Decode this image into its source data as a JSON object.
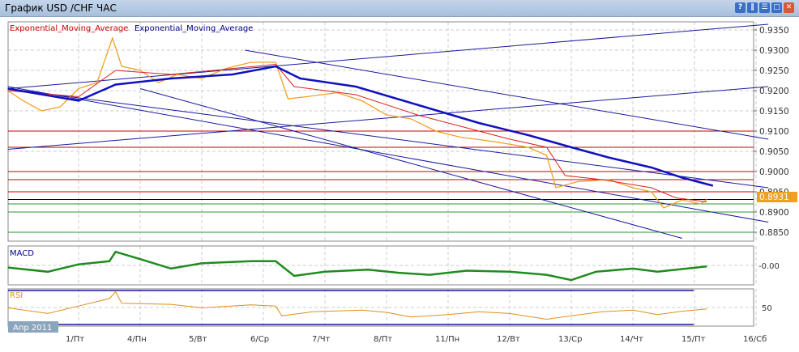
{
  "window": {
    "title": "График USD /CHF  ЧАС",
    "buttons": [
      "?",
      "‖",
      "☰",
      "□",
      "✕"
    ]
  },
  "chart_data": {
    "type": "line",
    "title": "График USD /CHF  ЧАС",
    "legend": [
      "Exponential_Moving_Average",
      "Exponential_Moving_Average"
    ],
    "period_label": "Апр 2011",
    "x_ticks": [
      {
        "t": 0,
        "label": "1/Пт"
      },
      {
        "t": 1,
        "label": "4/Пн"
      },
      {
        "t": 2,
        "label": "5/Вт"
      },
      {
        "t": 3,
        "label": "6/Ср"
      },
      {
        "t": 4,
        "label": "7/Чт"
      },
      {
        "t": 5,
        "label": "8/Пт"
      },
      {
        "t": 6,
        "label": "11/Пн"
      },
      {
        "t": 7,
        "label": "12/Вт"
      },
      {
        "t": 8,
        "label": "13/Ср"
      },
      {
        "t": 9,
        "label": "14/Чт"
      },
      {
        "t": 10,
        "label": "15/Пт"
      },
      {
        "t": 11,
        "label": "16/Сб"
      }
    ],
    "y_ticks": [
      "0.9350",
      "0.9300",
      "0.9250",
      "0.9200",
      "0.9150",
      "0.9100",
      "0.9050",
      "0.9000",
      "0.8950",
      "0.8900",
      "0.8850"
    ],
    "ylim": [
      0.883,
      0.9365
    ],
    "current_price": "0.8931",
    "price": [
      [
        -1.15,
        0.92
      ],
      [
        -0.9,
        0.9175
      ],
      [
        -0.6,
        0.915
      ],
      [
        -0.3,
        0.916
      ],
      [
        0,
        0.9205
      ],
      [
        0.3,
        0.922
      ],
      [
        0.55,
        0.933
      ],
      [
        0.7,
        0.926
      ],
      [
        1.0,
        0.925
      ],
      [
        1.3,
        0.922
      ],
      [
        1.6,
        0.924
      ],
      [
        2.0,
        0.923
      ],
      [
        2.4,
        0.9255
      ],
      [
        2.8,
        0.927
      ],
      [
        3.2,
        0.927
      ],
      [
        3.4,
        0.918
      ],
      [
        3.7,
        0.9185
      ],
      [
        4.2,
        0.9195
      ],
      [
        4.6,
        0.9175
      ],
      [
        5.0,
        0.914
      ],
      [
        5.4,
        0.913
      ],
      [
        5.8,
        0.91
      ],
      [
        6.2,
        0.9085
      ],
      [
        6.7,
        0.9075
      ],
      [
        7.3,
        0.906
      ],
      [
        7.6,
        0.904
      ],
      [
        7.75,
        0.896
      ],
      [
        8.1,
        0.8975
      ],
      [
        8.6,
        0.898
      ],
      [
        9.0,
        0.896
      ],
      [
        9.3,
        0.895
      ],
      [
        9.5,
        0.891
      ],
      [
        9.8,
        0.893
      ],
      [
        10.1,
        0.892
      ],
      [
        10.2,
        0.8931
      ]
    ],
    "ema_red": [
      [
        -1.15,
        0.92
      ],
      [
        0,
        0.9185
      ],
      [
        0.6,
        0.925
      ],
      [
        1.5,
        0.924
      ],
      [
        3.2,
        0.9265
      ],
      [
        3.5,
        0.921
      ],
      [
        4.5,
        0.919
      ],
      [
        5.5,
        0.914
      ],
      [
        7.0,
        0.908
      ],
      [
        7.6,
        0.906
      ],
      [
        7.9,
        0.899
      ],
      [
        8.5,
        0.898
      ],
      [
        9.3,
        0.896
      ],
      [
        9.7,
        0.8935
      ],
      [
        10.2,
        0.8925
      ]
    ],
    "ema_blue": [
      [
        -1.15,
        0.9205
      ],
      [
        0,
        0.9175
      ],
      [
        0.6,
        0.9215
      ],
      [
        1.5,
        0.923
      ],
      [
        2.5,
        0.924
      ],
      [
        3.2,
        0.926
      ],
      [
        3.6,
        0.923
      ],
      [
        4.5,
        0.921
      ],
      [
        5.5,
        0.9165
      ],
      [
        6.5,
        0.912
      ],
      [
        7.3,
        0.909
      ],
      [
        8.0,
        0.906
      ],
      [
        8.6,
        0.9035
      ],
      [
        9.3,
        0.901
      ],
      [
        9.8,
        0.8985
      ],
      [
        10.3,
        0.8965
      ]
    ],
    "horizontal_levels": [
      {
        "price": 0.91,
        "color": "#cc0000"
      },
      {
        "price": 0.906,
        "color": "#cc0000"
      },
      {
        "price": 0.9,
        "color": "#cc0000"
      },
      {
        "price": 0.898,
        "color": "#cc0000"
      },
      {
        "price": 0.895,
        "color": "#cc0000"
      },
      {
        "price": 0.8931,
        "color": "#000000"
      },
      {
        "price": 0.892,
        "color": "#2e9a2e"
      },
      {
        "price": 0.89,
        "color": "#2e9a2e"
      },
      {
        "price": 0.885,
        "color": "#2e9a2e"
      }
    ],
    "trendlines": [
      [
        [
          -1.15,
          0.9205
        ],
        [
          11.2,
          0.9364
        ]
      ],
      [
        [
          -1.15,
          0.9055
        ],
        [
          11.2,
          0.921
        ]
      ],
      [
        [
          -1.15,
          0.921
        ],
        [
          11.2,
          0.8875
        ]
      ],
      [
        [
          1.0,
          0.9205
        ],
        [
          9.8,
          0.8835
        ]
      ],
      [
        [
          2.7,
          0.93
        ],
        [
          11.2,
          0.908
        ]
      ],
      [
        [
          -1.15,
          0.9205
        ],
        [
          11.2,
          0.896
        ]
      ]
    ],
    "macd": {
      "label": "MACD",
      "tick": "-0.00",
      "series": [
        [
          -1.15,
          -0.002
        ],
        [
          -0.5,
          -0.006
        ],
        [
          0,
          0.001
        ],
        [
          0.5,
          0.004
        ],
        [
          0.6,
          0.013
        ],
        [
          1.0,
          0.006
        ],
        [
          1.5,
          -0.003
        ],
        [
          2.0,
          0.002
        ],
        [
          2.8,
          0.004
        ],
        [
          3.2,
          0.004
        ],
        [
          3.5,
          -0.01
        ],
        [
          4.0,
          -0.006
        ],
        [
          4.7,
          -0.004
        ],
        [
          5.2,
          -0.007
        ],
        [
          5.7,
          -0.009
        ],
        [
          6.3,
          -0.005
        ],
        [
          7.0,
          -0.006
        ],
        [
          7.6,
          -0.009
        ],
        [
          8.0,
          -0.014
        ],
        [
          8.4,
          -0.006
        ],
        [
          9.0,
          -0.003
        ],
        [
          9.4,
          -0.006
        ],
        [
          10.2,
          -0.001
        ]
      ],
      "range": [
        -0.017,
        0.017
      ]
    },
    "rsi": {
      "label": "RSI",
      "tick": "50",
      "series": [
        [
          -1.15,
          52
        ],
        [
          -0.5,
          42
        ],
        [
          0,
          55
        ],
        [
          0.5,
          68
        ],
        [
          0.6,
          80
        ],
        [
          0.7,
          60
        ],
        [
          1.5,
          58
        ],
        [
          2.0,
          52
        ],
        [
          2.8,
          57
        ],
        [
          3.2,
          55
        ],
        [
          3.3,
          38
        ],
        [
          3.8,
          45
        ],
        [
          4.6,
          48
        ],
        [
          5.0,
          44
        ],
        [
          5.4,
          36
        ],
        [
          6.0,
          40
        ],
        [
          6.5,
          45
        ],
        [
          7.0,
          42
        ],
        [
          7.6,
          32
        ],
        [
          8.0,
          38
        ],
        [
          8.5,
          45
        ],
        [
          9.0,
          48
        ],
        [
          9.4,
          40
        ],
        [
          9.8,
          46
        ],
        [
          10.2,
          50
        ]
      ],
      "range": [
        20,
        85
      ]
    }
  }
}
